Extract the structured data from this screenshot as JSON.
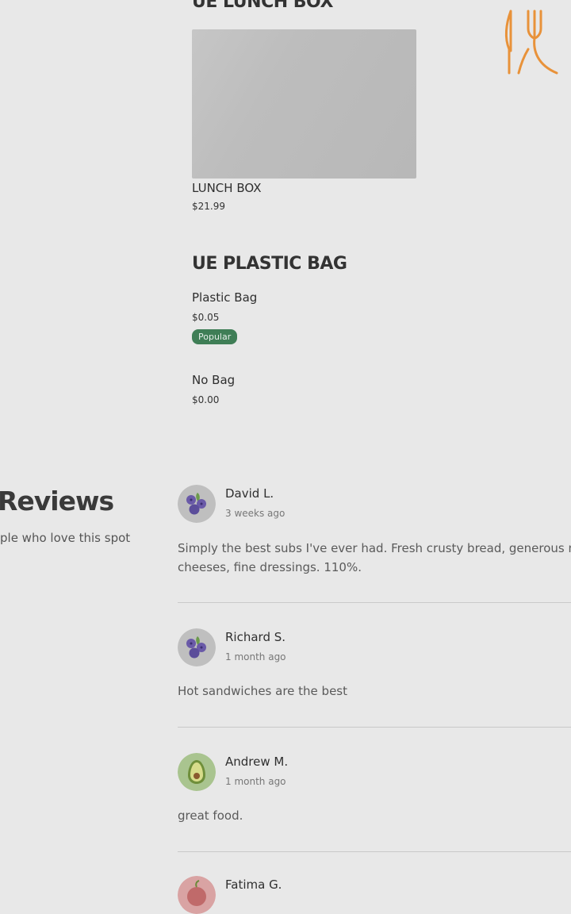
{
  "menu": {
    "sections": [
      {
        "title": "UE LUNCH BOX",
        "items": [
          {
            "name": "LUNCH BOX",
            "price": "$21.99"
          }
        ]
      },
      {
        "title": "UE PLASTIC BAG",
        "items": [
          {
            "name": "Plastic Bag",
            "price": "$0.05",
            "badge": "Popular"
          },
          {
            "name": "No Bag",
            "price": "$0.00"
          }
        ]
      }
    ]
  },
  "reviews": {
    "heading": "Reviews",
    "subheading": "ple who love this spot",
    "items": [
      {
        "name": "David L.",
        "date": "3 weeks ago",
        "text": "Simply the best subs I've ever had. Fresh crusty bread, generous m cheeses, fine dressings. 110%.",
        "avatar": "blueberry-icon"
      },
      {
        "name": "Richard S.",
        "date": "1 month ago",
        "text": "Hot sandwiches are the best",
        "avatar": "blueberry-icon"
      },
      {
        "name": "Andrew M.",
        "date": "1 month ago",
        "text": "great food.",
        "avatar": "avocado-icon"
      },
      {
        "name": "Fatima G.",
        "date": "",
        "text": "",
        "avatar": "peach-icon"
      }
    ]
  },
  "colors": {
    "accent_orange": "#e8923a",
    "badge_green": "#3f7e56",
    "background": "#e8e8e8"
  }
}
